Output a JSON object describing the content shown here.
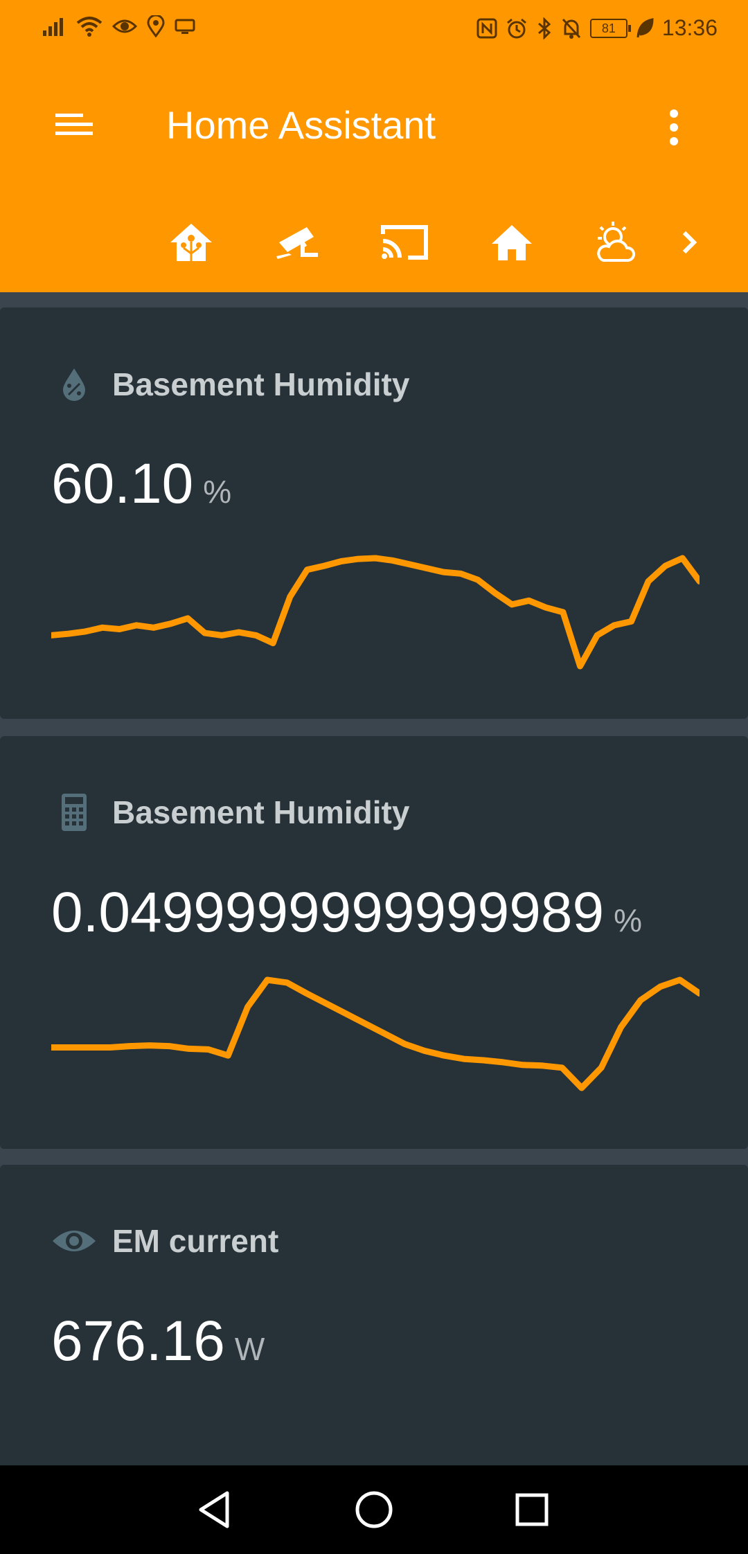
{
  "status_bar": {
    "time": "13:36",
    "battery": "81",
    "left_icons": [
      "signal-icon",
      "wifi-icon",
      "eye-icon",
      "location-icon",
      "screen-icon"
    ],
    "right_icons": [
      "nfc-icon",
      "alarm-icon",
      "bluetooth-icon",
      "notifications-off-icon",
      "battery-icon",
      "leaf-icon"
    ]
  },
  "app_bar": {
    "title": "Home Assistant",
    "menu_icon": "menu-icon",
    "overflow_icon": "more-vert-icon",
    "tabs": [
      {
        "icon": "home-assistant-icon"
      },
      {
        "icon": "cctv-icon"
      },
      {
        "icon": "cast-icon"
      },
      {
        "icon": "home-icon"
      },
      {
        "icon": "weather-partly-cloudy-icon"
      }
    ],
    "next_icon": "chevron-right-icon",
    "accent": "#ff9800"
  },
  "cards": [
    {
      "name": "Basement Humidity",
      "icon": "water-percent-icon",
      "value": "60.10",
      "unit": "%",
      "sparkline": [
        60.0,
        60.02,
        60.05,
        60.1,
        60.08,
        60.13,
        60.1,
        60.15,
        60.22,
        60.03,
        60.0,
        60.04,
        60.0,
        59.9,
        60.5,
        60.85,
        60.9,
        60.96,
        60.99,
        61.0,
        60.97,
        60.92,
        60.87,
        60.82,
        60.8,
        60.72,
        60.55,
        60.4,
        60.45,
        60.36,
        60.3,
        59.6,
        60.0,
        60.13,
        60.18,
        60.7,
        60.9,
        61.0,
        60.7
      ]
    },
    {
      "name": "Basement Humidity",
      "icon": "calculator-icon",
      "value": "0.0499999999999989",
      "unit": "%",
      "sparkline": [
        0.0,
        0.0,
        0.0,
        0.0,
        0.002,
        0.003,
        0.002,
        -0.002,
        -0.003,
        -0.012,
        0.06,
        0.1,
        0.096,
        0.08,
        0.065,
        0.05,
        0.035,
        0.02,
        0.005,
        -0.005,
        -0.012,
        -0.017,
        -0.019,
        -0.022,
        -0.026,
        -0.027,
        -0.03,
        -0.06,
        -0.03,
        0.03,
        0.07,
        0.09,
        0.1,
        0.08
      ]
    },
    {
      "name": "EM current",
      "icon": "eye-icon",
      "value": "676.16",
      "unit": "W"
    }
  ],
  "nav_bar": {
    "buttons": [
      "back-icon",
      "home-circle-icon",
      "recents-icon"
    ]
  }
}
